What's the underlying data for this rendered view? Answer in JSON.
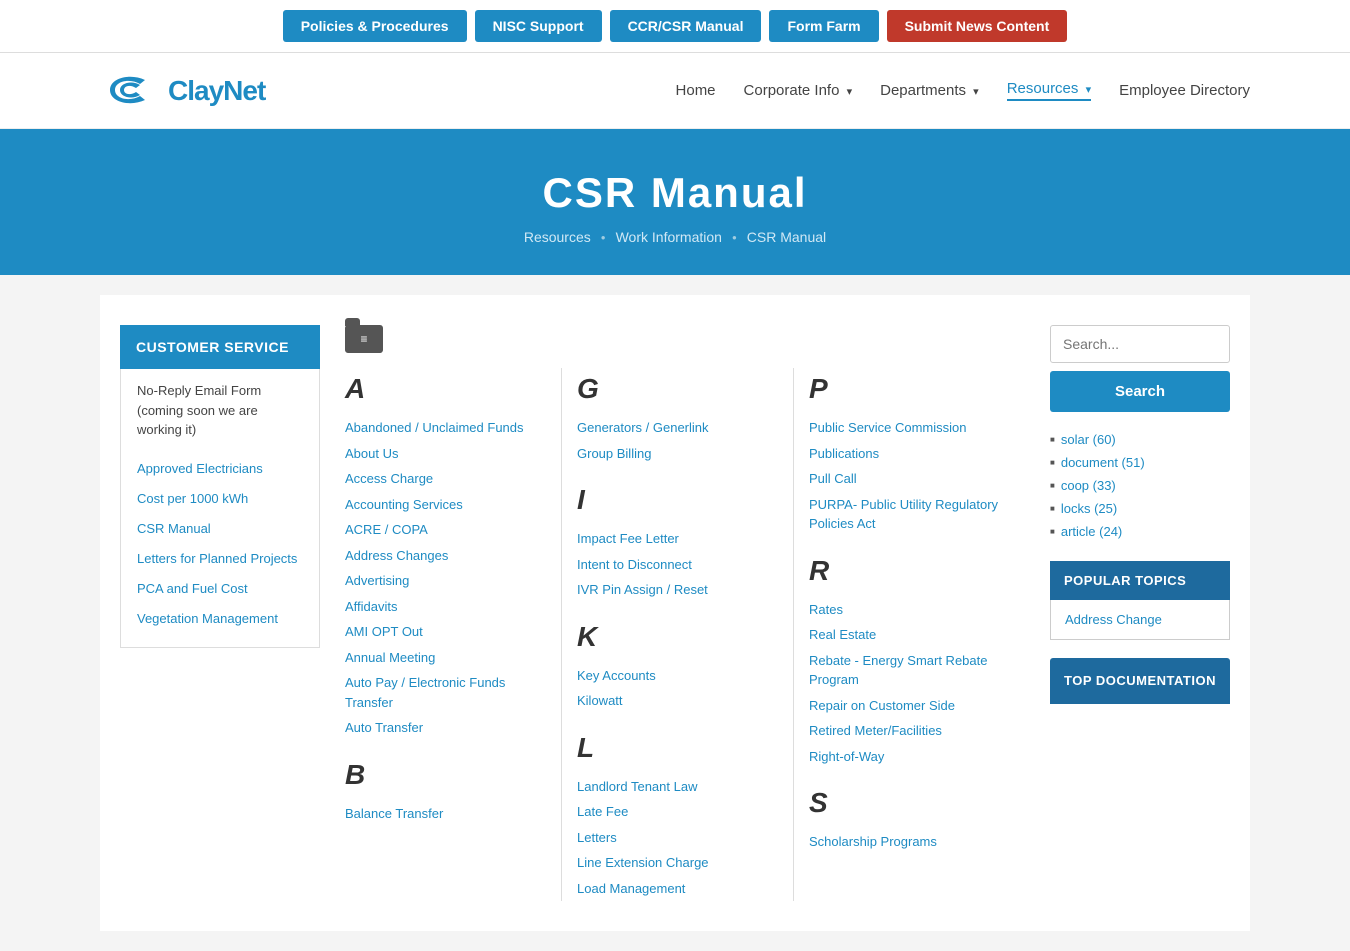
{
  "topbar": {
    "buttons": [
      {
        "label": "Policies & Procedures",
        "style": "blue",
        "name": "policies-btn"
      },
      {
        "label": "NISC Support",
        "style": "blue",
        "name": "nisc-btn"
      },
      {
        "label": "CCR/CSR Manual",
        "style": "blue",
        "name": "ccr-btn"
      },
      {
        "label": "Form Farm",
        "style": "blue",
        "name": "formfarm-btn"
      },
      {
        "label": "Submit News Content",
        "style": "red",
        "name": "submit-btn"
      }
    ]
  },
  "nav": {
    "logo_text": "ClayNet",
    "links": [
      {
        "label": "Home",
        "active": false,
        "has_arrow": false
      },
      {
        "label": "Corporate Info",
        "active": false,
        "has_arrow": true
      },
      {
        "label": "Departments",
        "active": false,
        "has_arrow": true
      },
      {
        "label": "Resources",
        "active": true,
        "has_arrow": true
      },
      {
        "label": "Employee Directory",
        "active": false,
        "has_arrow": false
      }
    ]
  },
  "hero": {
    "title": "CSR Manual",
    "breadcrumb": [
      "Resources",
      "Work Information",
      "CSR Manual"
    ]
  },
  "sidebar": {
    "header": "CUSTOMER SERVICE",
    "notice": "No-Reply Email Form (coming soon we are working it)",
    "links": [
      "Approved Electricians",
      "Cost per 1000 kWh",
      "CSR Manual",
      "Letters for Planned Projects",
      "PCA and Fuel Cost",
      "Vegetation Management"
    ]
  },
  "content": {
    "sections": [
      {
        "letter": "A",
        "links": [
          "Abandoned / Unclaimed Funds",
          "About Us",
          "Access Charge",
          "Accounting Services",
          "ACRE / COPA",
          "Address Changes",
          "Advertising",
          "Affidavits",
          "AMI OPT Out",
          "Annual Meeting",
          "Auto Pay / Electronic Funds Transfer",
          "Auto Transfer"
        ]
      },
      {
        "letter": "B",
        "links": [
          "Balance Transfer"
        ]
      },
      {
        "letter": "G",
        "links": [
          "Generators / Generlink",
          "Group Billing"
        ]
      },
      {
        "letter": "I",
        "links": [
          "Impact Fee Letter",
          "Intent to Disconnect",
          "IVR Pin Assign / Reset"
        ]
      },
      {
        "letter": "K",
        "links": [
          "Key Accounts",
          "Kilowatt"
        ]
      },
      {
        "letter": "L",
        "links": [
          "Landlord Tenant Law",
          "Late Fee",
          "Letters",
          "Line Extension Charge",
          "Load Management"
        ]
      },
      {
        "letter": "P",
        "links": [
          "Public Service Commission",
          "Publications",
          "Pull Call",
          "PURPA- Public Utility Regulatory Policies Act"
        ]
      },
      {
        "letter": "R",
        "links": [
          "Rates",
          "Real Estate",
          "Rebate - Energy Smart Rebate Program",
          "Repair on Customer Side",
          "Retired Meter/Facilities",
          "Right-of-Way"
        ]
      },
      {
        "letter": "S",
        "links": [
          "Scholarship Programs"
        ]
      }
    ]
  },
  "right_sidebar": {
    "search_placeholder": "Search...",
    "search_btn": "Search",
    "tags": [
      "solar (60)",
      "document (51)",
      "coop (33)",
      "locks (25)",
      "article (24)"
    ],
    "popular_topics_header": "POPULAR TOPICS",
    "popular_links": [
      "Address Change"
    ],
    "top_doc_header": "TOP DOCUMENTATION"
  }
}
